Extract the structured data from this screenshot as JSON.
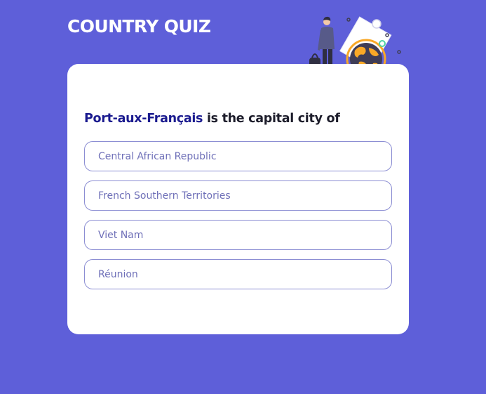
{
  "header": {
    "title": "COUNTRY QUIZ"
  },
  "question": {
    "highlight": "Port-aux-Français",
    "text": " is the capital city of"
  },
  "options": [
    {
      "label": "Central African Republic"
    },
    {
      "label": "French Southern Territories"
    },
    {
      "label": "Viet Nam"
    },
    {
      "label": "Réunion"
    }
  ],
  "colors": {
    "background": "#5e5fd9",
    "card": "#ffffff",
    "question_highlight": "#1b1b8f",
    "option_border": "#8c8ed3",
    "option_text": "#6f70b8",
    "globe_accent": "#f9a826"
  },
  "illustration": {
    "icon": "traveler-with-globe-icon"
  }
}
